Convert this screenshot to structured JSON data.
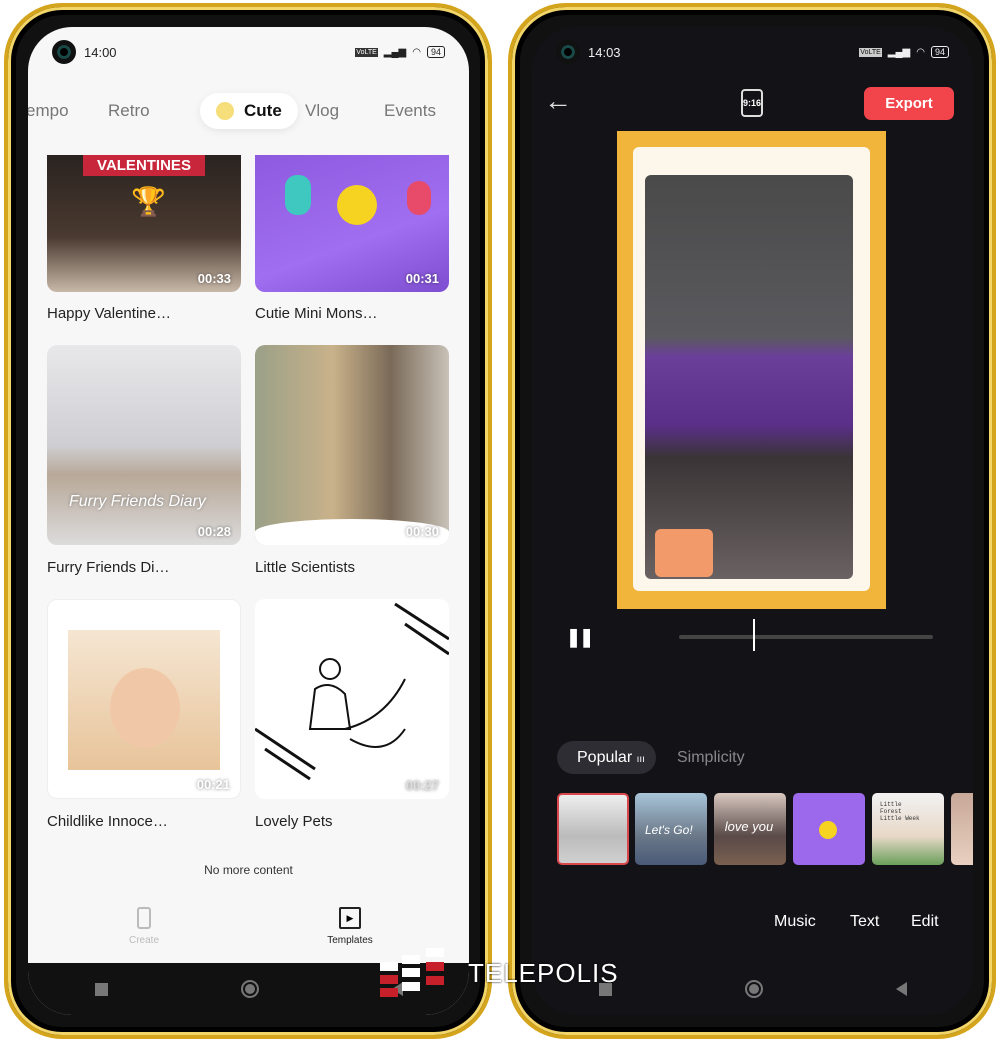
{
  "left": {
    "status": {
      "time": "14:00",
      "network": "VoLTE",
      "battery": "94"
    },
    "tabs": [
      {
        "label": "empo"
      },
      {
        "label": "Retro"
      },
      {
        "label": "Cute",
        "active": true
      },
      {
        "label": "Vlog"
      },
      {
        "label": "Events"
      }
    ],
    "templates": [
      {
        "title": "Happy Valentine…",
        "duration": "00:33",
        "banner": "VALENTINES"
      },
      {
        "title": "Cutie Mini Mons…",
        "duration": "00:31"
      },
      {
        "title": "Furry Friends Di…",
        "duration": "00:28",
        "overlay": "Furry Friends Diary"
      },
      {
        "title": "Little Scientists",
        "duration": "00:30"
      },
      {
        "title": "Childlike Innoce…",
        "duration": "00:21"
      },
      {
        "title": "Lovely Pets",
        "duration": "00:27"
      }
    ],
    "end_text": "No more content",
    "bottom_nav": [
      {
        "label": "Create",
        "icon": "create-icon"
      },
      {
        "label": "Templates",
        "icon": "templates-icon",
        "active": true
      }
    ]
  },
  "right": {
    "status": {
      "time": "14:03",
      "network": "VoLTE",
      "battery": "94"
    },
    "aspect_ratio": "9:16",
    "export_label": "Export",
    "progress": 0.29,
    "style_tabs": [
      {
        "label": "Popular",
        "active": true
      },
      {
        "label": "Simplicity"
      }
    ],
    "thumb_texts": [
      "Let's Go!",
      "love you",
      "Little Forest Little Week"
    ],
    "actions": [
      "Music",
      "Text",
      "Edit"
    ]
  },
  "watermark": "TELEPOLIS",
  "colors": {
    "accent": "#f2454b",
    "frame": "#d4a51c",
    "preview_border": "#f0b53a"
  }
}
